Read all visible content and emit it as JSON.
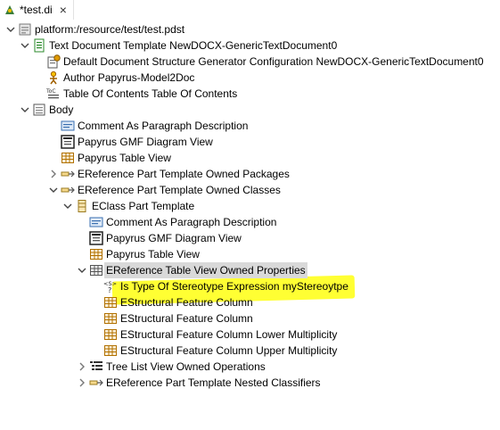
{
  "tab": {
    "title": "*test.di",
    "close": "×",
    "icon": "papyrus-doc-icon"
  },
  "colors": {
    "highlight": "#ffff33",
    "selection": "#d9d9d9"
  },
  "tree": [
    {
      "label": "platform:/resource/test/test.pdst",
      "icon": "resource-icon",
      "expanded": true
    },
    {
      "label": "Text Document Template NewDOCX-GenericTextDocument0",
      "icon": "template-icon",
      "expanded": true
    },
    {
      "label": "Default Document Structure Generator Configuration NewDOCX-GenericTextDocument0",
      "icon": "config-icon"
    },
    {
      "label": "Author Papyrus-Model2Doc",
      "icon": "author-icon"
    },
    {
      "label": "Table Of Contents Table Of Contents",
      "icon": "toc-icon"
    },
    {
      "label": "Body",
      "icon": "body-icon",
      "expanded": true
    },
    {
      "label": "Comment As Paragraph Description",
      "icon": "comment-icon"
    },
    {
      "label": "Papyrus GMF Diagram View",
      "icon": "diagram-icon"
    },
    {
      "label": "Papyrus Table View",
      "icon": "table-icon"
    },
    {
      "label": "EReference Part Template Owned Packages",
      "icon": "ereference-icon",
      "expanded": false
    },
    {
      "label": "EReference Part Template Owned Classes",
      "icon": "ereference-icon",
      "expanded": true
    },
    {
      "label": "EClass Part Template",
      "icon": "eclass-icon",
      "expanded": true
    },
    {
      "label": "Comment As Paragraph Description",
      "icon": "comment-icon"
    },
    {
      "label": "Papyrus GMF Diagram View",
      "icon": "diagram-icon"
    },
    {
      "label": "Papyrus Table View",
      "icon": "table-icon"
    },
    {
      "label": "EReference Table View Owned Properties",
      "icon": "table-view-icon",
      "expanded": true,
      "selected": true
    },
    {
      "label": "Is Type Of Stereotype Expression myStereoytpe",
      "icon": "stereotype-expression-icon",
      "highlighted": true
    },
    {
      "label": "EStructural Feature Column",
      "icon": "column-icon"
    },
    {
      "label": "EStructural Feature Column",
      "icon": "column-icon"
    },
    {
      "label": "EStructural Feature Column Lower Multiplicity",
      "icon": "column-icon"
    },
    {
      "label": "EStructural Feature Column Upper Multiplicity",
      "icon": "column-icon"
    },
    {
      "label": "Tree List View Owned Operations",
      "icon": "tree-list-icon",
      "expanded": false
    },
    {
      "label": "EReference Part Template Nested Classifiers",
      "icon": "ereference-icon",
      "expanded": false
    }
  ]
}
